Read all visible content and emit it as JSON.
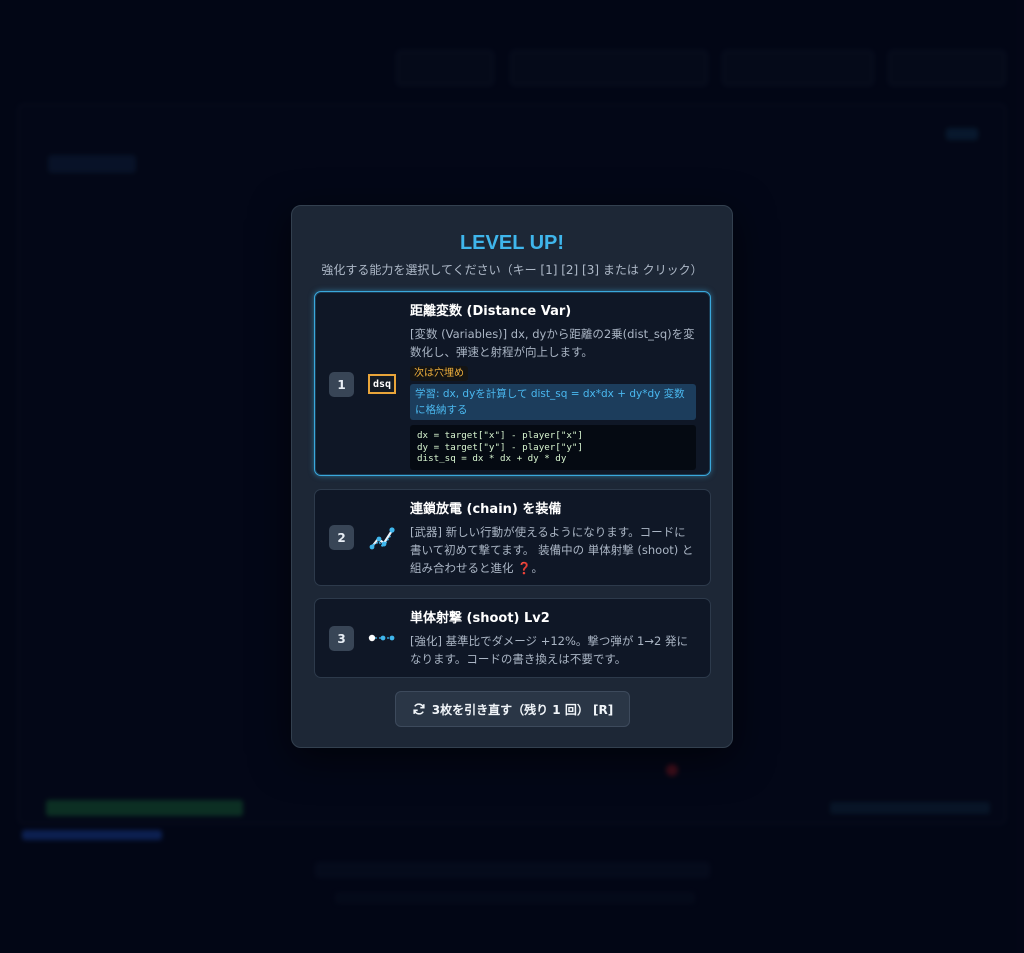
{
  "modal": {
    "title": "LEVEL UP!",
    "subtitle": "強化する能力を選択してください（キー [1] [2] [3] または クリック）",
    "cards": [
      {
        "number": "1",
        "icon": "dsq-variable-icon",
        "icon_text": "dsq",
        "title": "距離変数 (Distance Var)",
        "description": "[変数 (Variables)] dx, dyから距離の2乗(dist_sq)を変数化し、弾速と射程が向上します。",
        "next_tag": "次は穴埋め",
        "learn": "学習: dx, dyを計算して dist_sq = dx*dx + dy*dy 変数に格納する",
        "code": "dx = target[\"x\"] - player[\"x\"]\ndy = target[\"y\"] - player[\"y\"]\ndist_sq = dx * dx + dy * dy",
        "selected": true
      },
      {
        "number": "2",
        "icon": "chain-lightning-icon",
        "title": "連鎖放電 (chain) を装備",
        "description_before": "[武器] 新しい行動が使えるようになります。コードに書いて初めて撃てます。 装備中の 単体射撃 (shoot) と組み合わせると進化 ",
        "description_mark": "❓",
        "description_after": "。"
      },
      {
        "number": "3",
        "icon": "shoot-bullet-icon",
        "title": "単体射撃 (shoot) Lv2",
        "description": "[強化] 基準比でダメージ +12%。撃つ弾が 1→2 発になります。コードの書き換えは不要です。"
      }
    ],
    "reroll_label": "3枚を引き直す（残り 1 回） [R]"
  },
  "colors": {
    "accent": "#3fb6ec",
    "selected_border": "#3aa8dc",
    "badge_orange": "#e9a53a",
    "modal_bg": "#1d2736",
    "page_bg": "#03071a"
  }
}
